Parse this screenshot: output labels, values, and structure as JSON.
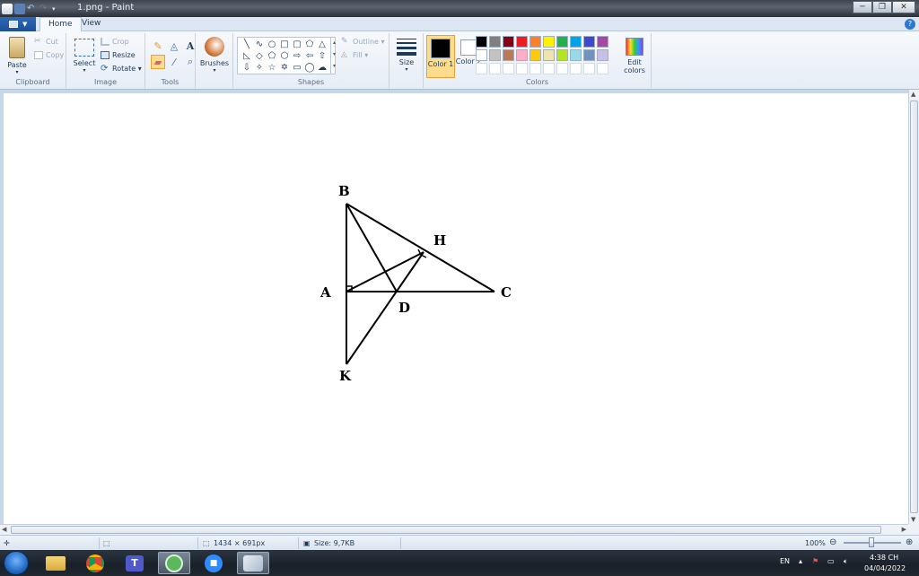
{
  "window": {
    "title": "1.png - Paint",
    "min_glyph": "─",
    "max_glyph": "❐",
    "close_glyph": "✕"
  },
  "tabs": [
    {
      "label": "Home",
      "active": true
    },
    {
      "label": "View",
      "active": false
    }
  ],
  "ribbon": {
    "clipboard": {
      "label": "Clipboard",
      "paste": "Paste",
      "cut": "Cut",
      "copy": "Copy"
    },
    "image": {
      "label": "Image",
      "select": "Select",
      "crop": "Crop",
      "resize": "Resize",
      "rotate": "Rotate"
    },
    "tools": {
      "label": "Tools",
      "selected": "eraser"
    },
    "brushes": {
      "label": "Brushes"
    },
    "shapes": {
      "label": "Shapes",
      "outline": "Outline",
      "fill": "Fill"
    },
    "size": {
      "label": "Size"
    },
    "colors": {
      "label": "Colors",
      "color1": {
        "label": "Color 1",
        "value": "#000000"
      },
      "color2": {
        "label": "Color 2",
        "value": "#ffffff"
      },
      "edit": "Edit colors",
      "palette_row1": [
        "#000000",
        "#7f7f7f",
        "#880015",
        "#ed1c24",
        "#ff7f27",
        "#fff200",
        "#22b14c",
        "#00a2e8",
        "#3f48cc",
        "#a349a4"
      ],
      "palette_row2": [
        "#ffffff",
        "#c3c3c3",
        "#b97a57",
        "#ffaec9",
        "#ffc90e",
        "#efe4b0",
        "#b5e61d",
        "#99d9ea",
        "#7092be",
        "#c8bfe7"
      ],
      "palette_row3": [
        "#ffffff",
        "#ffffff",
        "#ffffff",
        "#ffffff",
        "#ffffff",
        "#ffffff",
        "#ffffff",
        "#ffffff",
        "#ffffff",
        "#ffffff"
      ]
    }
  },
  "figure": {
    "labels": {
      "B": "B",
      "H": "H",
      "A": "A",
      "C": "C",
      "D": "D",
      "K": "K"
    }
  },
  "status": {
    "dimensions": "1434 × 691px",
    "size": "Size: 9,7KB",
    "zoom": "100%"
  },
  "taskbar": {
    "language": "EN",
    "time": "4:38 CH",
    "date": "04/04/2022"
  }
}
